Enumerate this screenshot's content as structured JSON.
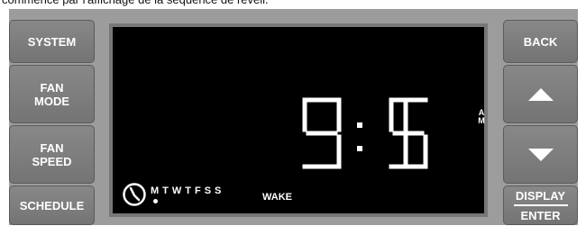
{
  "caption": "commence par l'affichage de la séquence de réveil.",
  "left_buttons": {
    "system": "SYSTEM",
    "fan_mode_line1": "FAN",
    "fan_mode_line2": "MODE",
    "fan_speed_line1": "FAN",
    "fan_speed_line2": "SPEED",
    "schedule": "SCHEDULE"
  },
  "right_buttons": {
    "back": "BACK",
    "up_icon": "triangle-up-icon",
    "down_icon": "triangle-down-icon",
    "display": "DISPLAY",
    "enter": "ENTER"
  },
  "display": {
    "time": "9:15",
    "am_pm_top": "A",
    "am_pm_bottom": "M",
    "days": "MTWTFSS",
    "selected_day": "M",
    "period": "WAKE",
    "clock_icon": "clock-icon",
    "digit_color": "#ffffff",
    "background_color": "#000000"
  }
}
